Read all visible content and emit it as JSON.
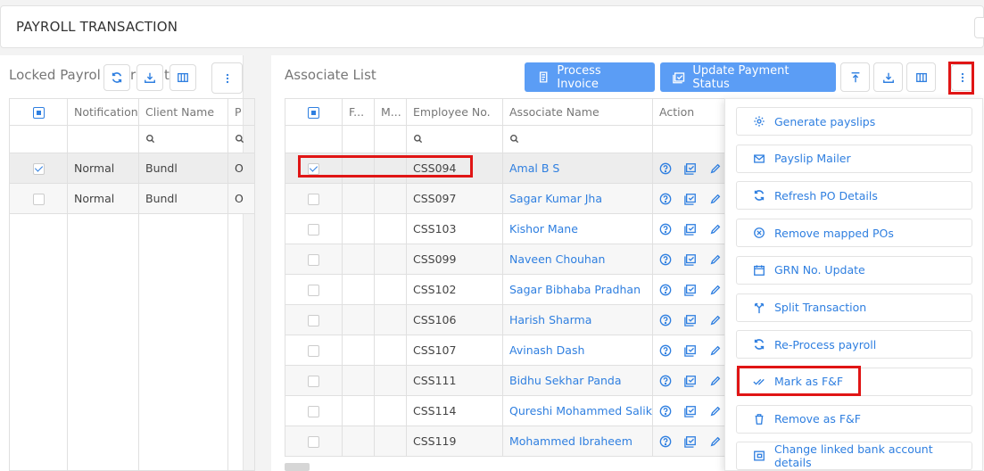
{
  "header": {
    "title": "PAYROLL TRANSACTION"
  },
  "left_panel": {
    "title": "Locked Payrol",
    "title_tail": "t",
    "title_mid": "r",
    "columns": [
      "Notification",
      "Client Name",
      "P"
    ],
    "rows": [
      {
        "notification": "Normal",
        "client": "Bundl",
        "p": "O",
        "checked": true
      },
      {
        "notification": "Normal",
        "client": "Bundl",
        "p": "O",
        "checked": false
      }
    ]
  },
  "right_panel": {
    "title": "Associate List",
    "buttons": {
      "process_invoice": "Process Invoice",
      "update_payment_status": "Update Payment Status"
    },
    "columns": [
      "F...",
      "M...",
      "Employee No.",
      "Associate Name",
      "Action"
    ],
    "rows": [
      {
        "emp": "CSS094",
        "name": "Amal B S",
        "checked": true
      },
      {
        "emp": "CSS097",
        "name": "Sagar Kumar Jha",
        "checked": false
      },
      {
        "emp": "CSS103",
        "name": "Kishor Mane",
        "checked": false
      },
      {
        "emp": "CSS099",
        "name": "Naveen Chouhan",
        "checked": false
      },
      {
        "emp": "CSS102",
        "name": "Sagar Bibhaba Pradhan",
        "checked": false
      },
      {
        "emp": "CSS106",
        "name": "Harish Sharma",
        "checked": false
      },
      {
        "emp": "CSS107",
        "name": "Avinash Dash",
        "checked": false
      },
      {
        "emp": "CSS111",
        "name": "Bidhu Sekhar Panda",
        "checked": false
      },
      {
        "emp": "CSS114",
        "name": "Qureshi Mohammed Salik",
        "checked": false
      },
      {
        "emp": "CSS119",
        "name": "Mohammed Ibraheem",
        "checked": false
      }
    ]
  },
  "menu": {
    "items": [
      {
        "label": "Generate payslips",
        "icon": "gear-icon"
      },
      {
        "label": "Payslip Mailer",
        "icon": "mail-icon"
      },
      {
        "label": "Refresh PO Details",
        "icon": "refresh-icon"
      },
      {
        "label": "Remove mapped POs",
        "icon": "remove-circle-icon"
      },
      {
        "label": "GRN No. Update",
        "icon": "calendar-icon"
      },
      {
        "label": "Split Transaction",
        "icon": "split-icon"
      },
      {
        "label": "Re-Process payroll",
        "icon": "refresh-icon"
      },
      {
        "label": "Mark as F&F",
        "icon": "double-check-icon"
      },
      {
        "label": "Remove as F&F",
        "icon": "trash-icon"
      },
      {
        "label": "Change linked bank account details",
        "icon": "bank-card-icon"
      }
    ]
  },
  "colors": {
    "primary": "#5b9df5",
    "link": "#2f7fe0",
    "highlight": "#e01515"
  }
}
